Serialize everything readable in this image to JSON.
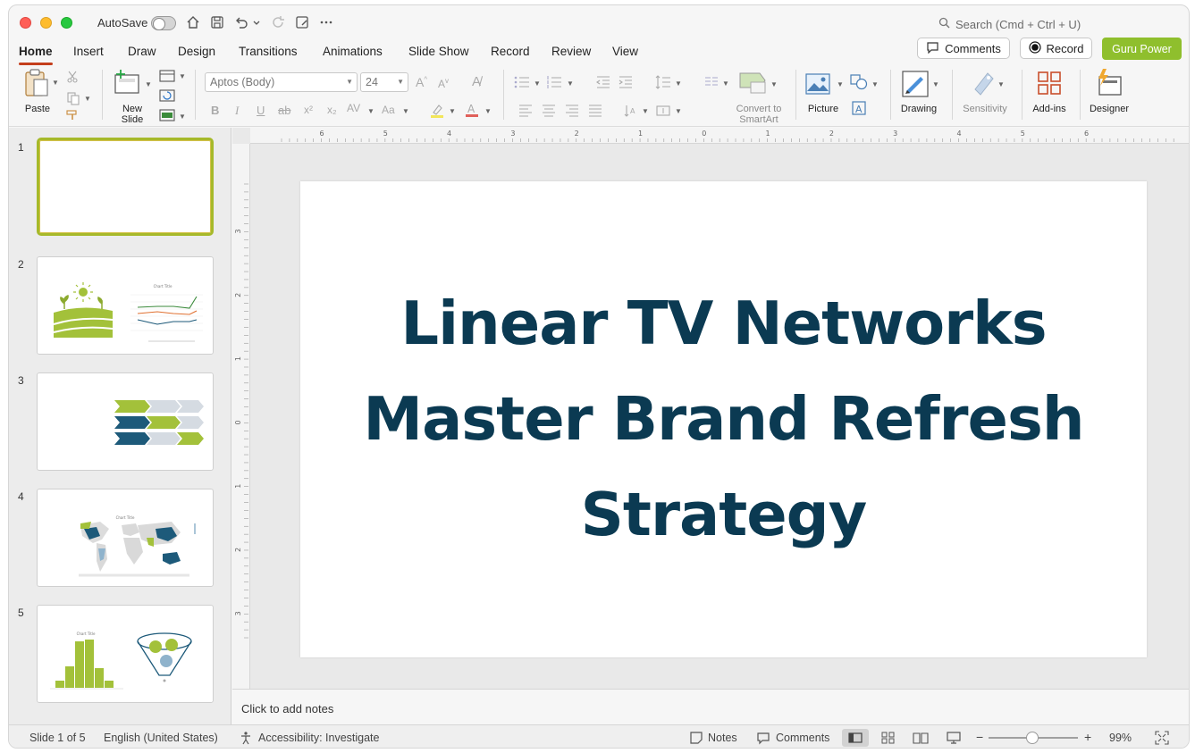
{
  "titlebar": {
    "autosave_label": "AutoSave",
    "search_placeholder": "Search (Cmd + Ctrl + U)"
  },
  "tabs": [
    "Home",
    "Insert",
    "Draw",
    "Design",
    "Transitions",
    "Animations",
    "Slide Show",
    "Record",
    "Review",
    "View"
  ],
  "header_buttons": {
    "comments": "Comments",
    "record": "Record",
    "guru": "Guru Power"
  },
  "ribbon": {
    "paste": "Paste",
    "new_slide_1": "New",
    "new_slide_2": "Slide",
    "font_name": "Aptos (Body)",
    "font_size": "24",
    "convert_1": "Convert to",
    "convert_2": "SmartArt",
    "picture": "Picture",
    "drawing": "Drawing",
    "sensitivity": "Sensitivity",
    "addins": "Add-ins",
    "designer": "Designer"
  },
  "ruler": {
    "h_labels": [
      "6",
      "5",
      "4",
      "3",
      "2",
      "1",
      "0",
      "1",
      "2",
      "3",
      "4",
      "5",
      "6"
    ],
    "v_labels": [
      "3",
      "2",
      "1",
      "0",
      "1",
      "2",
      "3"
    ]
  },
  "slides": [
    {
      "number": "1"
    },
    {
      "number": "2",
      "chart_title": "Chart Title"
    },
    {
      "number": "3"
    },
    {
      "number": "4",
      "chart_title": "Chart Title"
    },
    {
      "number": "5",
      "chart_title": "Chart Title"
    }
  ],
  "slide": {
    "title": "Linear TV Networks Master Brand Refresh Strategy"
  },
  "notes": {
    "placeholder": "Click to add notes"
  },
  "status": {
    "slide_count": "Slide 1 of 5",
    "language": "English (United States)",
    "accessibility": "Accessibility: Investigate",
    "notes": "Notes",
    "comments": "Comments",
    "zoom_minus": "−",
    "zoom_plus": "+",
    "zoom": "99%"
  },
  "colors": {
    "accent_tab": "#c43e1c",
    "guru_green": "#8fbf2d",
    "title_navy": "#0b3a52",
    "thumb_green": "#a3c13a",
    "thumb_blue": "#1d5a7a"
  }
}
